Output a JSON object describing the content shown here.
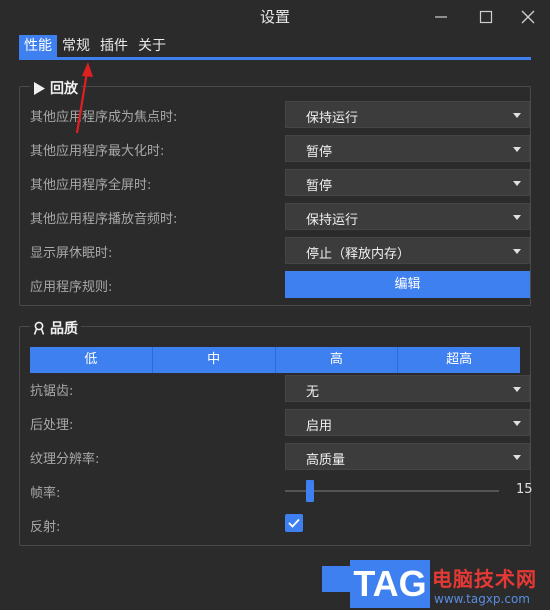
{
  "window": {
    "title": "设置",
    "controls": [
      "minimize-icon",
      "maximize-icon",
      "close-icon"
    ]
  },
  "tabs": [
    {
      "label": "性能",
      "active": true
    },
    {
      "label": "常规",
      "active": false
    },
    {
      "label": "插件",
      "active": false
    },
    {
      "label": "关于",
      "active": false
    }
  ],
  "playback": {
    "title": "回放",
    "icon": "play-icon",
    "rows": [
      {
        "label": "其他应用程序成为焦点时:",
        "value": "保持运行"
      },
      {
        "label": "其他应用程序最大化时:",
        "value": "暂停"
      },
      {
        "label": "其他应用程序全屏时:",
        "value": "暂停"
      },
      {
        "label": "其他应用程序播放音频时:",
        "value": "保持运行"
      },
      {
        "label": "显示屏休眠时:",
        "value": "停止（释放内存）"
      }
    ],
    "rules_label": "应用程序规则:",
    "edit_button": "编辑"
  },
  "quality": {
    "title": "品质",
    "icon": "ribbon-icon",
    "presets": [
      "低",
      "中",
      "高",
      "超高"
    ],
    "antialias_label": "抗锯齿:",
    "antialias_value": "无",
    "postprocess_label": "后处理:",
    "postprocess_value": "启用",
    "texture_label": "纹理分辨率:",
    "texture_value": "高质量",
    "framerate_label": "帧率:",
    "framerate_value": "15",
    "reflection_label": "反射:",
    "reflection_checked": true
  },
  "watermark": {
    "tag": "TAG",
    "site_name": "电脑技术网",
    "url": "www.tagxp.com"
  },
  "colors": {
    "accent": "#3e80f0",
    "background": "#2b2b2b",
    "annotation_arrow": "#e02020"
  }
}
